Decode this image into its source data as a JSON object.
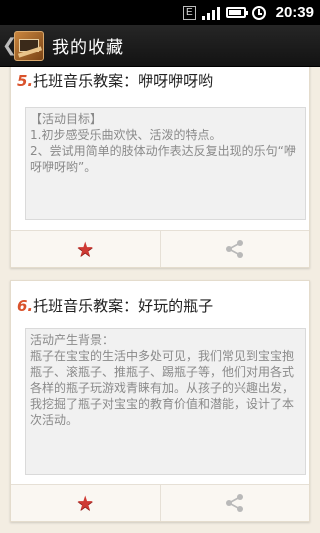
{
  "status_bar": {
    "network_label": "E",
    "time": "20:39",
    "battery_level": 0.85
  },
  "header": {
    "title": "我的收藏",
    "back_icon": "chevron-left-icon",
    "app_icon": "blackboard-app-icon"
  },
  "cards": [
    {
      "number": "5.",
      "title": "托班音乐教案：咿呀咿呀哟",
      "description": [
        "【活动目标】",
        "1.初步感受乐曲欢快、活泼的特点。",
        "2、尝试用简单的肢体动作表达反复出现的乐句“咿呀咿呀哟”。"
      ],
      "favorite_icon": "star-icon",
      "share_icon": "share-icon"
    },
    {
      "number": "6.",
      "title": "托班音乐教案：好玩的瓶子",
      "description": [
        "活动产生背景：",
        "瓶子在宝宝的生活中多处可见，我们常见到宝宝抱瓶子、滚瓶子、推瓶子、踢瓶子等，他们对用各式各样的瓶子玩游戏青睐有加。从孩子的兴趣出发，我挖掘了瓶子对宝宝的教育价值和潜能，设计了本次活动。"
      ],
      "favorite_icon": "star-icon",
      "share_icon": "share-icon"
    }
  ],
  "colors": {
    "accent_number": "#d9532c",
    "favorite": "#cf3a34",
    "background": "#f3ede2"
  }
}
